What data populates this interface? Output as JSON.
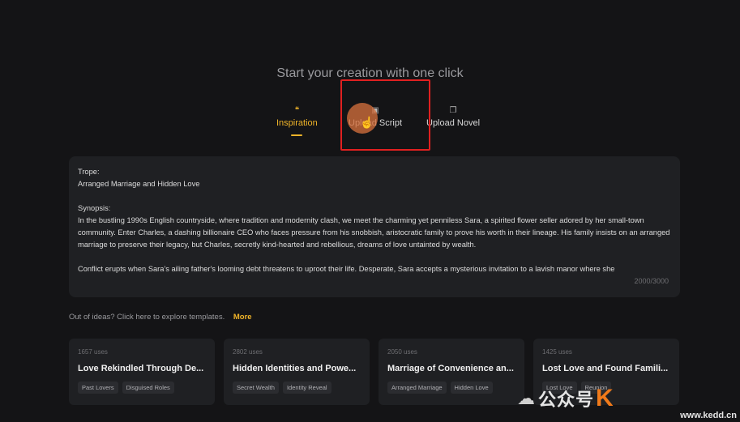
{
  "heading": "Start your creation with one click",
  "tabs": {
    "inspiration": {
      "icon": "❝",
      "label": "Inspiration"
    },
    "upload_script": {
      "icon": "▣",
      "label": "Upload Script"
    },
    "upload_novel": {
      "icon": "❐",
      "label": "Upload Novel"
    }
  },
  "editor": {
    "trope_label": "Trope:",
    "trope_value": "Arranged Marriage and Hidden Love",
    "synopsis_label": "Synopsis:",
    "synopsis_p1": "In the bustling 1990s English countryside, where tradition and modernity clash, we meet the charming yet penniless Sara, a spirited flower seller adored by her small-town community. Enter Charles, a dashing billionaire CEO who faces pressure from his snobbish, aristocratic family to prove his worth in their lineage. His family insists on an arranged marriage to preserve their legacy, but Charles, secretly kind-hearted and rebellious, dreams of love untainted by wealth.",
    "synopsis_p2": "Conflict erupts when Sara's ailing father's looming debt threatens to uproot their life. Desperate, Sara accepts a mysterious invitation to a lavish manor where she",
    "counter": "2000/3000"
  },
  "explore": {
    "text": "Out of ideas? Click here to explore templates.",
    "more": "More"
  },
  "templates": [
    {
      "uses": "1657 uses",
      "title": "Love Rekindled Through De...",
      "tags": [
        "Past Lovers",
        "Disguised Roles"
      ]
    },
    {
      "uses": "2802 uses",
      "title": "Hidden Identities and Powe...",
      "tags": [
        "Secret Wealth",
        "Identity Reveal"
      ]
    },
    {
      "uses": "2050 uses",
      "title": "Marriage of Convenience an...",
      "tags": [
        "Arranged Marriage",
        "Hidden Love"
      ]
    },
    {
      "uses": "1425 uses",
      "title": "Lost Love and Found Famili...",
      "tags": [
        "Lost Love",
        "Reunion"
      ]
    }
  ],
  "watermark": {
    "text": "公众号",
    "brand": "K",
    "url": "www.kedd.cn"
  }
}
